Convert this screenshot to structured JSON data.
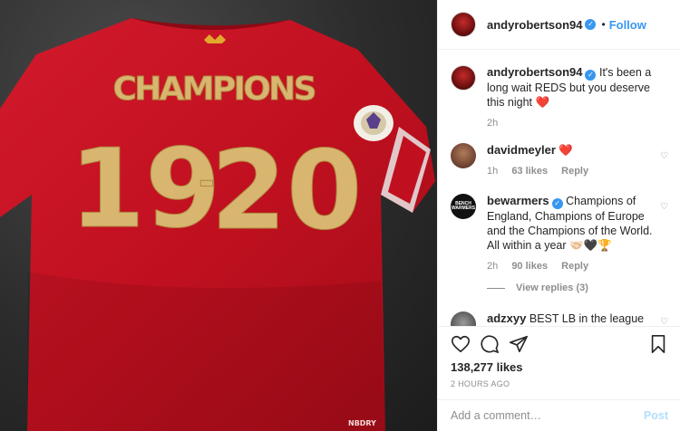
{
  "photo": {
    "jersey_word": "CHAMPIONS",
    "jersey_season_left": "19",
    "jersey_dash": "-",
    "jersey_season_right": "20",
    "sleeve_logo": "NBDRY"
  },
  "header": {
    "username": "andyrobertson94",
    "follow_label": "Follow",
    "separator": "•"
  },
  "caption": {
    "username": "andyrobertson94",
    "text": "It's been a long wait REDS but you deserve this night",
    "emoji": "❤️",
    "time": "2h"
  },
  "comments": [
    {
      "username": "davidmeyler",
      "text": "",
      "emoji": "❤️",
      "time": "1h",
      "likes": "63 likes",
      "reply": "Reply",
      "avatar_text": ""
    },
    {
      "username": "bewarmers",
      "text": "Champions of England, Champions of Europe and the Champions of the World. All within a year",
      "emoji": "🤝🏻🖤🏆",
      "time": "2h",
      "likes": "90 likes",
      "reply": "Reply",
      "avatar_text": "BENCH WARMERS"
    },
    {
      "username": "adzxyy",
      "text": "BEST LB in the league",
      "emoji": "🐐",
      "time": "",
      "likes": "",
      "reply": "",
      "avatar_text": ""
    }
  ],
  "view_replies": "View replies (3)",
  "likes_count": "138,277 likes",
  "time_ago": "2 HOURS AGO",
  "add_comment": {
    "placeholder": "Add a comment…",
    "post_label": "Post"
  },
  "colors": {
    "accent": "#3897f0",
    "heart": "#ed4956",
    "muted": "#8e8e8e",
    "jersey_red": "#c8102e",
    "jersey_gold": "#d8b670"
  },
  "icons": [
    "verified-icon",
    "heart-icon",
    "comment-icon",
    "share-icon",
    "bookmark-icon",
    "like-comment-icon"
  ]
}
